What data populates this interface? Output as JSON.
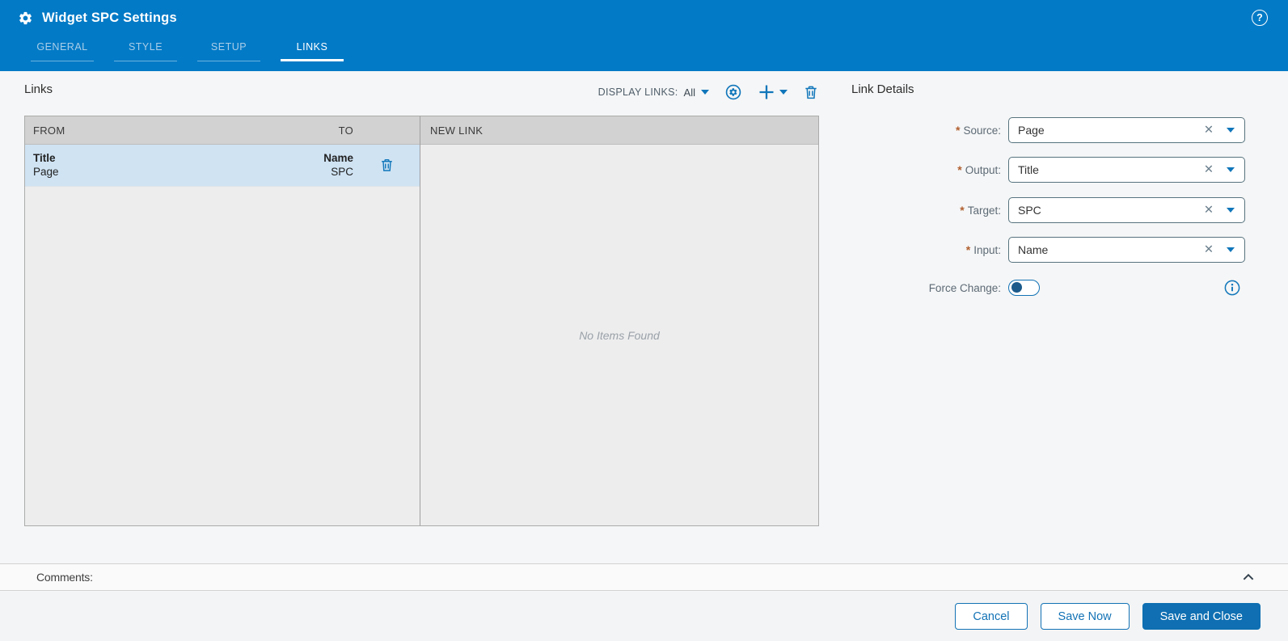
{
  "colors": {
    "header_blue": "#027ac6",
    "accent_blue": "#1076ba",
    "button_blue": "#0f6fb2",
    "selected_row_blue": "#cfe3f3",
    "required_marker_color": "#b05e2e",
    "table_header_gray": "#d2d2d2"
  },
  "icons": {
    "help": "?",
    "clear": "✕"
  },
  "header": {
    "title": "Widget SPC Settings",
    "tabs": [
      {
        "label": "GENERAL",
        "active": false
      },
      {
        "label": "STYLE",
        "active": false
      },
      {
        "label": "SETUP",
        "active": false
      },
      {
        "label": "LINKS",
        "active": true
      }
    ]
  },
  "links": {
    "title": "Links",
    "display_links_label": "DISPLAY LINKS:",
    "display_links_value": "All",
    "table": {
      "from_header": "FROM",
      "to_header": "TO",
      "new_link_header": "NEW LINK",
      "empty_text": "No Items Found",
      "rows": [
        {
          "from_primary": "Title",
          "from_secondary": "Page",
          "to_primary": "Name",
          "to_secondary": "SPC",
          "selected": true
        }
      ]
    }
  },
  "link_details": {
    "title": "Link Details",
    "required_marker": "*",
    "fields": [
      {
        "label": "Source:",
        "value": "Page",
        "required": true
      },
      {
        "label": "Output:",
        "value": "Title",
        "required": true
      },
      {
        "label": "Target:",
        "value": "SPC",
        "required": true
      },
      {
        "label": "Input:",
        "value": "Name",
        "required": true
      }
    ],
    "force_change_label": "Force Change:",
    "force_change_state": "off"
  },
  "comments": {
    "label": "Comments:"
  },
  "footer": {
    "cancel_label": "Cancel",
    "save_now_label": "Save Now",
    "save_close_label": "Save and Close"
  }
}
